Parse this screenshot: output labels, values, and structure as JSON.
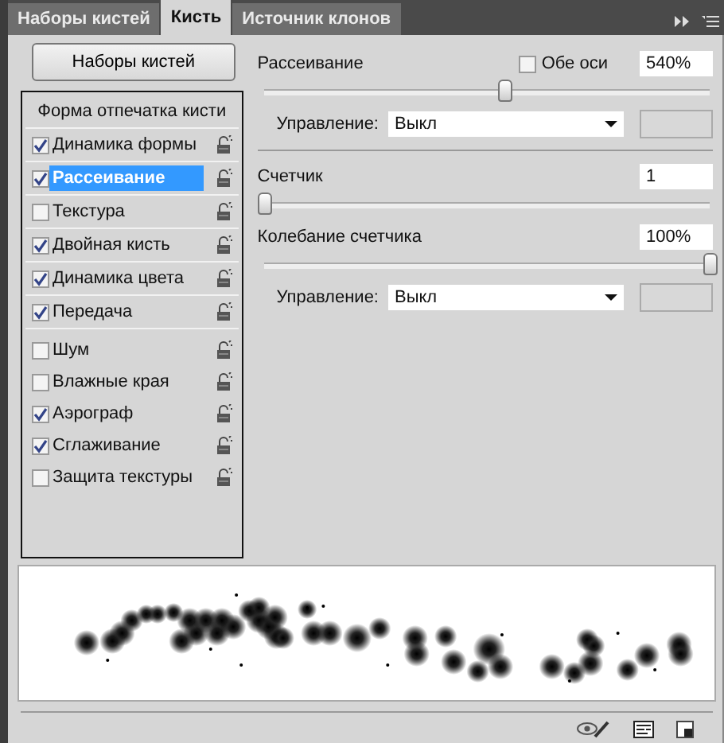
{
  "tabs": [
    {
      "label": "Наборы кистей",
      "selected": false
    },
    {
      "label": "Кисть",
      "selected": true
    },
    {
      "label": "Источник клонов",
      "selected": false
    }
  ],
  "preset_button": "Наборы кистей",
  "brush_list": {
    "header": "Форма отпечатка кисти",
    "groups": [
      {
        "kind": "ruled",
        "items": [
          {
            "label": "Динамика формы",
            "checked": true,
            "selected": false
          },
          {
            "label": "Рассеивание",
            "checked": true,
            "selected": true
          },
          {
            "label": "Текстура",
            "checked": false,
            "selected": false
          },
          {
            "label": "Двойная кисть",
            "checked": true,
            "selected": false
          },
          {
            "label": "Динамика цвета",
            "checked": true,
            "selected": false
          },
          {
            "label": "Передача",
            "checked": true,
            "selected": false
          }
        ]
      },
      {
        "kind": "plain",
        "items": [
          {
            "label": "Шум",
            "checked": false,
            "selected": false
          },
          {
            "label": "Влажные края",
            "checked": false,
            "selected": false
          },
          {
            "label": "Аэрограф",
            "checked": true,
            "selected": false
          },
          {
            "label": "Сглаживание",
            "checked": true,
            "selected": false
          },
          {
            "label": "Защита текстуры",
            "checked": false,
            "selected": false
          }
        ]
      }
    ]
  },
  "settings": [
    {
      "kind": "slider",
      "label": "Рассеивание",
      "option": {
        "label": "Обе оси",
        "checked": false
      },
      "value": "540%",
      "level": 0.54
    },
    {
      "kind": "control",
      "label": "Управление:",
      "value": "Выкл"
    },
    {
      "kind": "divider"
    },
    {
      "kind": "slider",
      "label": "Счетчик",
      "value": "1",
      "level": 0
    },
    {
      "kind": "slider",
      "label": "Колебание счетчика",
      "value": "100%",
      "level": 1
    },
    {
      "kind": "control",
      "label": "Управление:",
      "value": "Выкл"
    }
  ]
}
